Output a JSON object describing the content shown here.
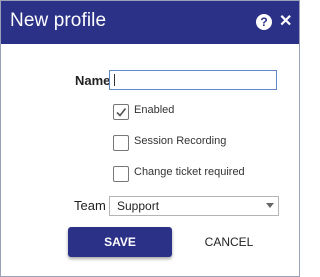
{
  "dialog": {
    "title": "New profile",
    "help_icon": "question-circle-icon",
    "close_icon": "close-icon"
  },
  "form": {
    "name_label": "Name",
    "name_value": "",
    "options": [
      {
        "label": "Enabled",
        "checked": true
      },
      {
        "label": "Session Recording",
        "checked": false
      },
      {
        "label": "Change ticket required",
        "checked": false
      }
    ],
    "team_label": "Team",
    "team_value": "Support"
  },
  "actions": {
    "save_label": "SAVE",
    "cancel_label": "CANCEL"
  },
  "colors": {
    "primary": "#2b3186",
    "input_focus_border": "#5f86c6"
  }
}
